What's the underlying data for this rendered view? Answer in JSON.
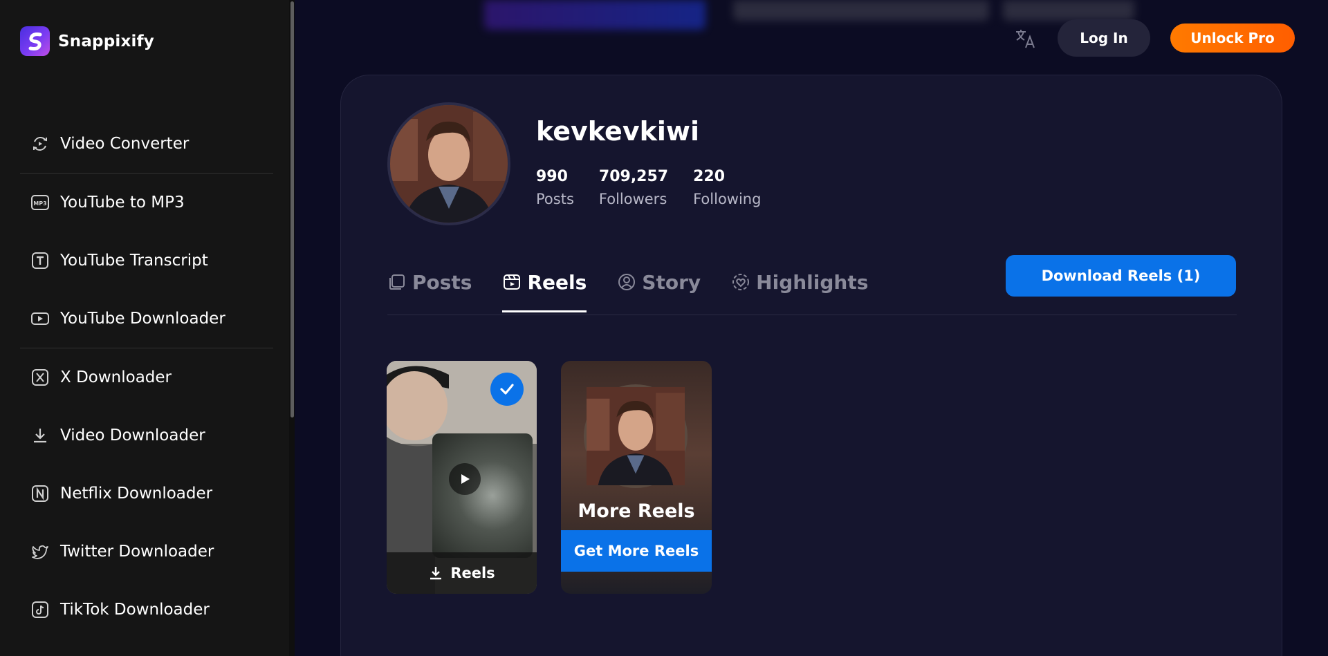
{
  "brand": {
    "name": "Snappixify",
    "logo_color": "#6a3cf0"
  },
  "sidebar": {
    "items": [
      {
        "label": "Video Converter",
        "icon": "convert-icon"
      },
      {
        "label": "YouTube to MP3",
        "icon": "mp3-icon"
      },
      {
        "label": "YouTube Transcript",
        "icon": "transcript-icon"
      },
      {
        "label": "YouTube Downloader",
        "icon": "youtube-icon"
      },
      {
        "label": "X Downloader",
        "icon": "x-icon"
      },
      {
        "label": "Video Downloader",
        "icon": "download-icon"
      },
      {
        "label": "Netflix Downloader",
        "icon": "netflix-icon"
      },
      {
        "label": "Twitter Downloader",
        "icon": "twitter-icon"
      },
      {
        "label": "TikTok Downloader",
        "icon": "tiktok-icon"
      }
    ]
  },
  "header": {
    "login_label": "Log In",
    "unlock_label": "Unlock Pro",
    "unlock_color": "#ff6a00"
  },
  "profile": {
    "username": "kevkevkiwi",
    "stats": [
      {
        "value": "990",
        "label": "Posts"
      },
      {
        "value": "709,257",
        "label": "Followers"
      },
      {
        "value": "220",
        "label": "Following"
      }
    ]
  },
  "tabs": [
    {
      "label": "Posts",
      "icon": "posts-icon",
      "active": false
    },
    {
      "label": "Reels",
      "icon": "reels-icon",
      "active": true
    },
    {
      "label": "Story",
      "icon": "story-icon",
      "active": false
    },
    {
      "label": "Highlights",
      "icon": "highlights-icon",
      "active": false
    }
  ],
  "download_button": {
    "label": "Download Reels (1)",
    "color": "#0a72e8"
  },
  "reels": {
    "item": {
      "footer_label": "Reels",
      "selected": true
    },
    "more_card": {
      "title": "More Reels",
      "button_label": "Get More Reels"
    }
  }
}
